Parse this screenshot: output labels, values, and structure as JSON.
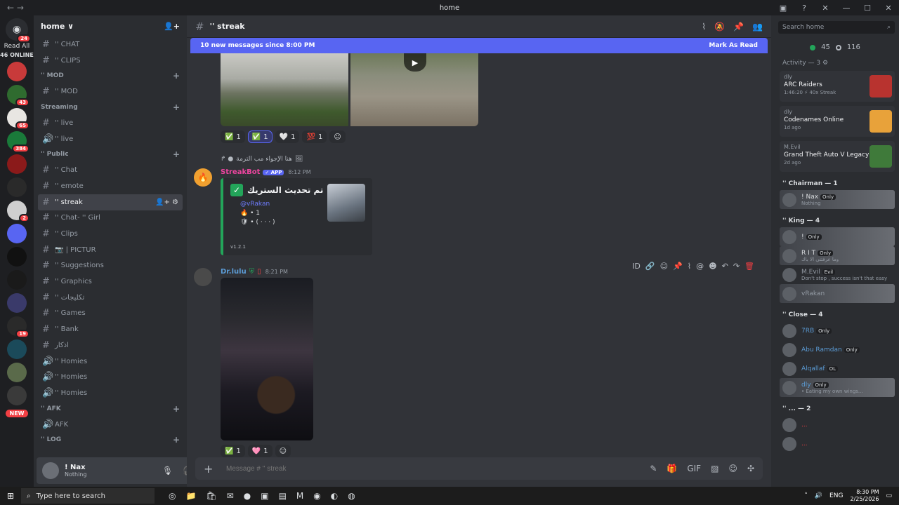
{
  "window": {
    "title": "home",
    "nav": "← →"
  },
  "rail": {
    "read_all": "Read All",
    "online": "46 ONLINE",
    "home_badge": "24",
    "servers": [
      {
        "color": "#c83a3a",
        "badge": ""
      },
      {
        "color": "#2f6b2f",
        "badge": "43"
      },
      {
        "color": "#e8e6e2",
        "badge": "65"
      },
      {
        "color": "#1a7a3a",
        "badge": "384"
      },
      {
        "color": "#8b1a1a",
        "badge": ""
      },
      {
        "color": "#2a2a2a",
        "badge": ""
      },
      {
        "color": "#cfcfcf",
        "badge": "2"
      },
      {
        "color": "#5865f2",
        "badge": ""
      },
      {
        "color": "#111111",
        "badge": ""
      },
      {
        "color": "#1a1a1a",
        "badge": ""
      },
      {
        "color": "#3a3a6a",
        "badge": ""
      },
      {
        "color": "#2a2a2a",
        "badge": "19"
      },
      {
        "color": "#1b4a5a",
        "badge": ""
      },
      {
        "color": "#5a6a4a",
        "badge": ""
      },
      {
        "color": "#3a3a3a",
        "badge": ""
      }
    ],
    "new_label": "NEW"
  },
  "guild": {
    "name": "home ∨"
  },
  "channel_list": [
    {
      "type": "ch",
      "label": "'' CHAT",
      "icon": "#"
    },
    {
      "type": "ch",
      "label": "'' CLIPS",
      "icon": "#"
    },
    {
      "type": "cat",
      "label": "'' MOD"
    },
    {
      "type": "ch",
      "label": "'' MOD",
      "icon": "#"
    },
    {
      "type": "cat",
      "label": "Streaming"
    },
    {
      "type": "ch",
      "label": "'' live",
      "icon": "#"
    },
    {
      "type": "ch",
      "label": "'' live",
      "icon": "🔊"
    },
    {
      "type": "cat",
      "label": "'' Public"
    },
    {
      "type": "ch",
      "label": "'' Chat",
      "icon": "#"
    },
    {
      "type": "ch",
      "label": "'' emote",
      "icon": "#"
    },
    {
      "type": "ch",
      "label": "'' streak",
      "icon": "#",
      "active": true
    },
    {
      "type": "ch",
      "label": "'' Chat- '' Girl",
      "icon": "#"
    },
    {
      "type": "ch",
      "label": "'' Clips",
      "icon": "#"
    },
    {
      "type": "ch",
      "label": "📷 | PICTUR",
      "icon": "#"
    },
    {
      "type": "ch",
      "label": "'' Suggestions",
      "icon": "#"
    },
    {
      "type": "ch",
      "label": "'' Graphics",
      "icon": "#"
    },
    {
      "type": "ch",
      "label": "'' تكليجات",
      "icon": "#"
    },
    {
      "type": "ch",
      "label": "'' Games",
      "icon": "#"
    },
    {
      "type": "ch",
      "label": "'' Bank",
      "icon": "#"
    },
    {
      "type": "ch",
      "label": "اذكار",
      "icon": "#"
    },
    {
      "type": "ch",
      "label": "'' Homies",
      "icon": "🔊"
    },
    {
      "type": "ch",
      "label": "'' Homies",
      "icon": "🔊"
    },
    {
      "type": "ch",
      "label": "'' Homies",
      "icon": "🔊"
    },
    {
      "type": "cat",
      "label": "'' AFK"
    },
    {
      "type": "ch",
      "label": "AFK",
      "icon": "🔊"
    },
    {
      "type": "cat",
      "label": "'' LOG"
    }
  ],
  "user": {
    "name": "! Nax",
    "status": "Nothing"
  },
  "header": {
    "channel": "'' streak"
  },
  "newbar": {
    "text": "10 new messages since 8:00 PM",
    "mark": "Mark As Read"
  },
  "reactions_top": [
    {
      "emoji": "✅",
      "count": "1",
      "me": false
    },
    {
      "emoji": "✅",
      "count": "1",
      "me": true
    },
    {
      "emoji": "🤍",
      "count": "1",
      "me": false
    },
    {
      "emoji": "💯",
      "count": "1",
      "me": false
    }
  ],
  "reply": {
    "text": "هنا الإجواء مب الترمة"
  },
  "bot_msg": {
    "name": "StreakBot",
    "tag": "✓ APP",
    "time": "8:12 PM",
    "title": "تم تحديث الستريك •",
    "line1": "@vRakan",
    "line2": "🔥 • 1",
    "line3": "🛡 • ( · · · )",
    "footer": "v1.2.1"
  },
  "lulu_msg": {
    "name": "Dr.lulu",
    "time": "8:21 PM"
  },
  "reactions_bottom": [
    {
      "emoji": "✅",
      "count": "1"
    },
    {
      "emoji": "🩷",
      "count": "1"
    }
  ],
  "composer": {
    "placeholder": "Message # '' streak"
  },
  "right": {
    "search_placeholder": "Search home",
    "online_count": "45",
    "offline_count": "116",
    "activity_header": "Activity — 3 ⚙",
    "activities": [
      {
        "user": "dly",
        "game": "ARC Raiders",
        "detail": "1:46:20 ⚡ 40x Streak",
        "color": "#b8332f"
      },
      {
        "user": "dly",
        "game": "Codenames Online",
        "detail": "1d ago",
        "color": "#e8a23a"
      },
      {
        "user": "M.Evil",
        "game": "Grand Theft Auto V Legacy",
        "detail": "2d ago",
        "color": "#3f7a3a"
      }
    ],
    "groups": [
      {
        "title": "'' Chairman — 1",
        "members": [
          {
            "name": "! Nax",
            "tag": "Only",
            "status": "Nothing",
            "hl": true,
            "color": "#dbdee1"
          }
        ]
      },
      {
        "title": "'' King — 4",
        "members": [
          {
            "name": "!",
            "tag": "Only",
            "status": "",
            "hl": true,
            "color": "#dbdee1"
          },
          {
            "name": "R I T",
            "tag": "Only",
            "status": "وما عرفتني الا باك",
            "hl": true,
            "color": "#dbdee1"
          },
          {
            "name": "M.Evil",
            "tag": "Evil",
            "status": "Don't stop , success isn't that easy",
            "hl": false,
            "color": "#949ba4"
          },
          {
            "name": "vRakan",
            "tag": "",
            "status": "",
            "hl": true,
            "color": "#949ba4"
          }
        ]
      },
      {
        "title": "'' Close — 4",
        "members": [
          {
            "name": "7RB",
            "tag": "Only",
            "status": "",
            "hl": false,
            "color": "#5b9bd5"
          },
          {
            "name": "Abu Ramdan",
            "tag": "Only",
            "status": "",
            "hl": false,
            "color": "#5b9bd5"
          },
          {
            "name": "Alqallaf",
            "tag": "OL",
            "status": "",
            "hl": false,
            "color": "#5b9bd5"
          },
          {
            "name": "dly",
            "tag": "Only",
            "status": "• Eating my own wings...",
            "hl": true,
            "color": "#5b9bd5"
          }
        ]
      },
      {
        "title": "'' ... — 2",
        "members": [
          {
            "name": "...",
            "tag": "",
            "status": "",
            "hl": false,
            "color": "#f23f43"
          },
          {
            "name": "...",
            "tag": "",
            "status": "",
            "hl": false,
            "color": "#f23f43"
          }
        ]
      }
    ]
  },
  "taskbar": {
    "search": "Type here to search",
    "lang": "ENG",
    "time": "8:30 PM",
    "date": "2/25/2026"
  }
}
